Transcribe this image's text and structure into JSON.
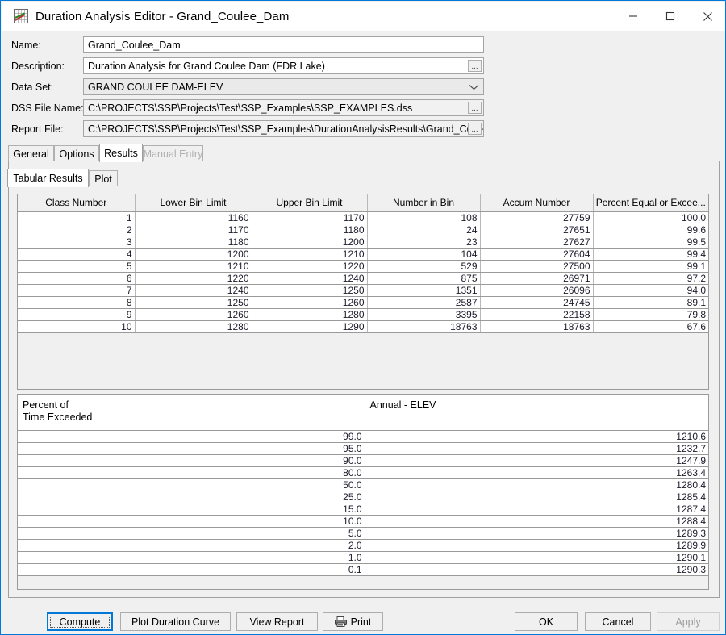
{
  "window": {
    "title": "Duration Analysis Editor - Grand_Coulee_Dam",
    "icon": "duration-chart-icon",
    "accent_color": "#0078d7",
    "controls": {
      "minimize": "minimize-icon",
      "maximize": "maximize-icon",
      "close": "close-icon"
    }
  },
  "form": {
    "fields": [
      {
        "label": "Name:",
        "value": "Grand_Coulee_Dam",
        "kind": "text",
        "browse": false
      },
      {
        "label": "Description:",
        "value": "Duration Analysis for Grand Coulee Dam (FDR Lake)",
        "kind": "text",
        "browse": true,
        "browse_label": "..."
      },
      {
        "label": "Data Set:",
        "value": "GRAND COULEE DAM-ELEV",
        "kind": "combo",
        "browse": false
      },
      {
        "label": "DSS File Name:",
        "value": "C:\\PROJECTS\\SSP\\Projects\\Test\\SSP_Examples\\SSP_EXAMPLES.dss",
        "kind": "readonly",
        "browse": true,
        "browse_label": "..."
      },
      {
        "label": "Report File:",
        "value": "C:\\PROJECTS\\SSP\\Projects\\Test\\SSP_Examples\\DurationAnalysisResults\\Grand_Coulee",
        "kind": "readonly",
        "browse": true,
        "browse_label": "..."
      }
    ]
  },
  "tabs": {
    "main": [
      {
        "label": "General",
        "selected": false,
        "enabled": true
      },
      {
        "label": "Options",
        "selected": false,
        "enabled": true
      },
      {
        "label": "Results",
        "selected": true,
        "enabled": true
      },
      {
        "label": "Manual Entry",
        "selected": false,
        "enabled": false
      }
    ],
    "sub": [
      {
        "label": "Tabular Results",
        "selected": true,
        "enabled": true
      },
      {
        "label": "Plot",
        "selected": false,
        "enabled": true
      }
    ]
  },
  "bin_table": {
    "columns": [
      "Class Number",
      "Lower Bin Limit",
      "Upper Bin Limit",
      "Number in Bin",
      "Accum Number",
      "Percent Equal or Excee..."
    ],
    "rows": [
      [
        "1",
        "1160",
        "1170",
        "108",
        "27759",
        "100.0"
      ],
      [
        "2",
        "1170",
        "1180",
        "24",
        "27651",
        "99.6"
      ],
      [
        "3",
        "1180",
        "1200",
        "23",
        "27627",
        "99.5"
      ],
      [
        "4",
        "1200",
        "1210",
        "104",
        "27604",
        "99.4"
      ],
      [
        "5",
        "1210",
        "1220",
        "529",
        "27500",
        "99.1"
      ],
      [
        "6",
        "1220",
        "1240",
        "875",
        "26971",
        "97.2"
      ],
      [
        "7",
        "1240",
        "1250",
        "1351",
        "26096",
        "94.0"
      ],
      [
        "8",
        "1250",
        "1260",
        "2587",
        "24745",
        "89.1"
      ],
      [
        "9",
        "1260",
        "1280",
        "3395",
        "22158",
        "79.8"
      ],
      [
        "10",
        "1280",
        "1290",
        "18763",
        "18763",
        "67.6"
      ]
    ]
  },
  "exceedance_table": {
    "columns": [
      "Percent of\nTime Exceeded",
      "Annual - ELEV"
    ],
    "rows": [
      [
        "99.0",
        "1210.6"
      ],
      [
        "95.0",
        "1232.7"
      ],
      [
        "90.0",
        "1247.9"
      ],
      [
        "80.0",
        "1263.4"
      ],
      [
        "50.0",
        "1280.4"
      ],
      [
        "25.0",
        "1285.4"
      ],
      [
        "15.0",
        "1287.4"
      ],
      [
        "10.0",
        "1288.4"
      ],
      [
        "5.0",
        "1289.3"
      ],
      [
        "2.0",
        "1289.9"
      ],
      [
        "1.0",
        "1290.1"
      ],
      [
        "0.1",
        "1290.3"
      ]
    ]
  },
  "buttons": {
    "compute": "Compute",
    "plot_duration_curve": "Plot Duration Curve",
    "view_report": "View Report",
    "print": "Print",
    "print_icon": "printer-icon",
    "ok": "OK",
    "cancel": "Cancel",
    "apply": "Apply",
    "apply_enabled": false
  }
}
